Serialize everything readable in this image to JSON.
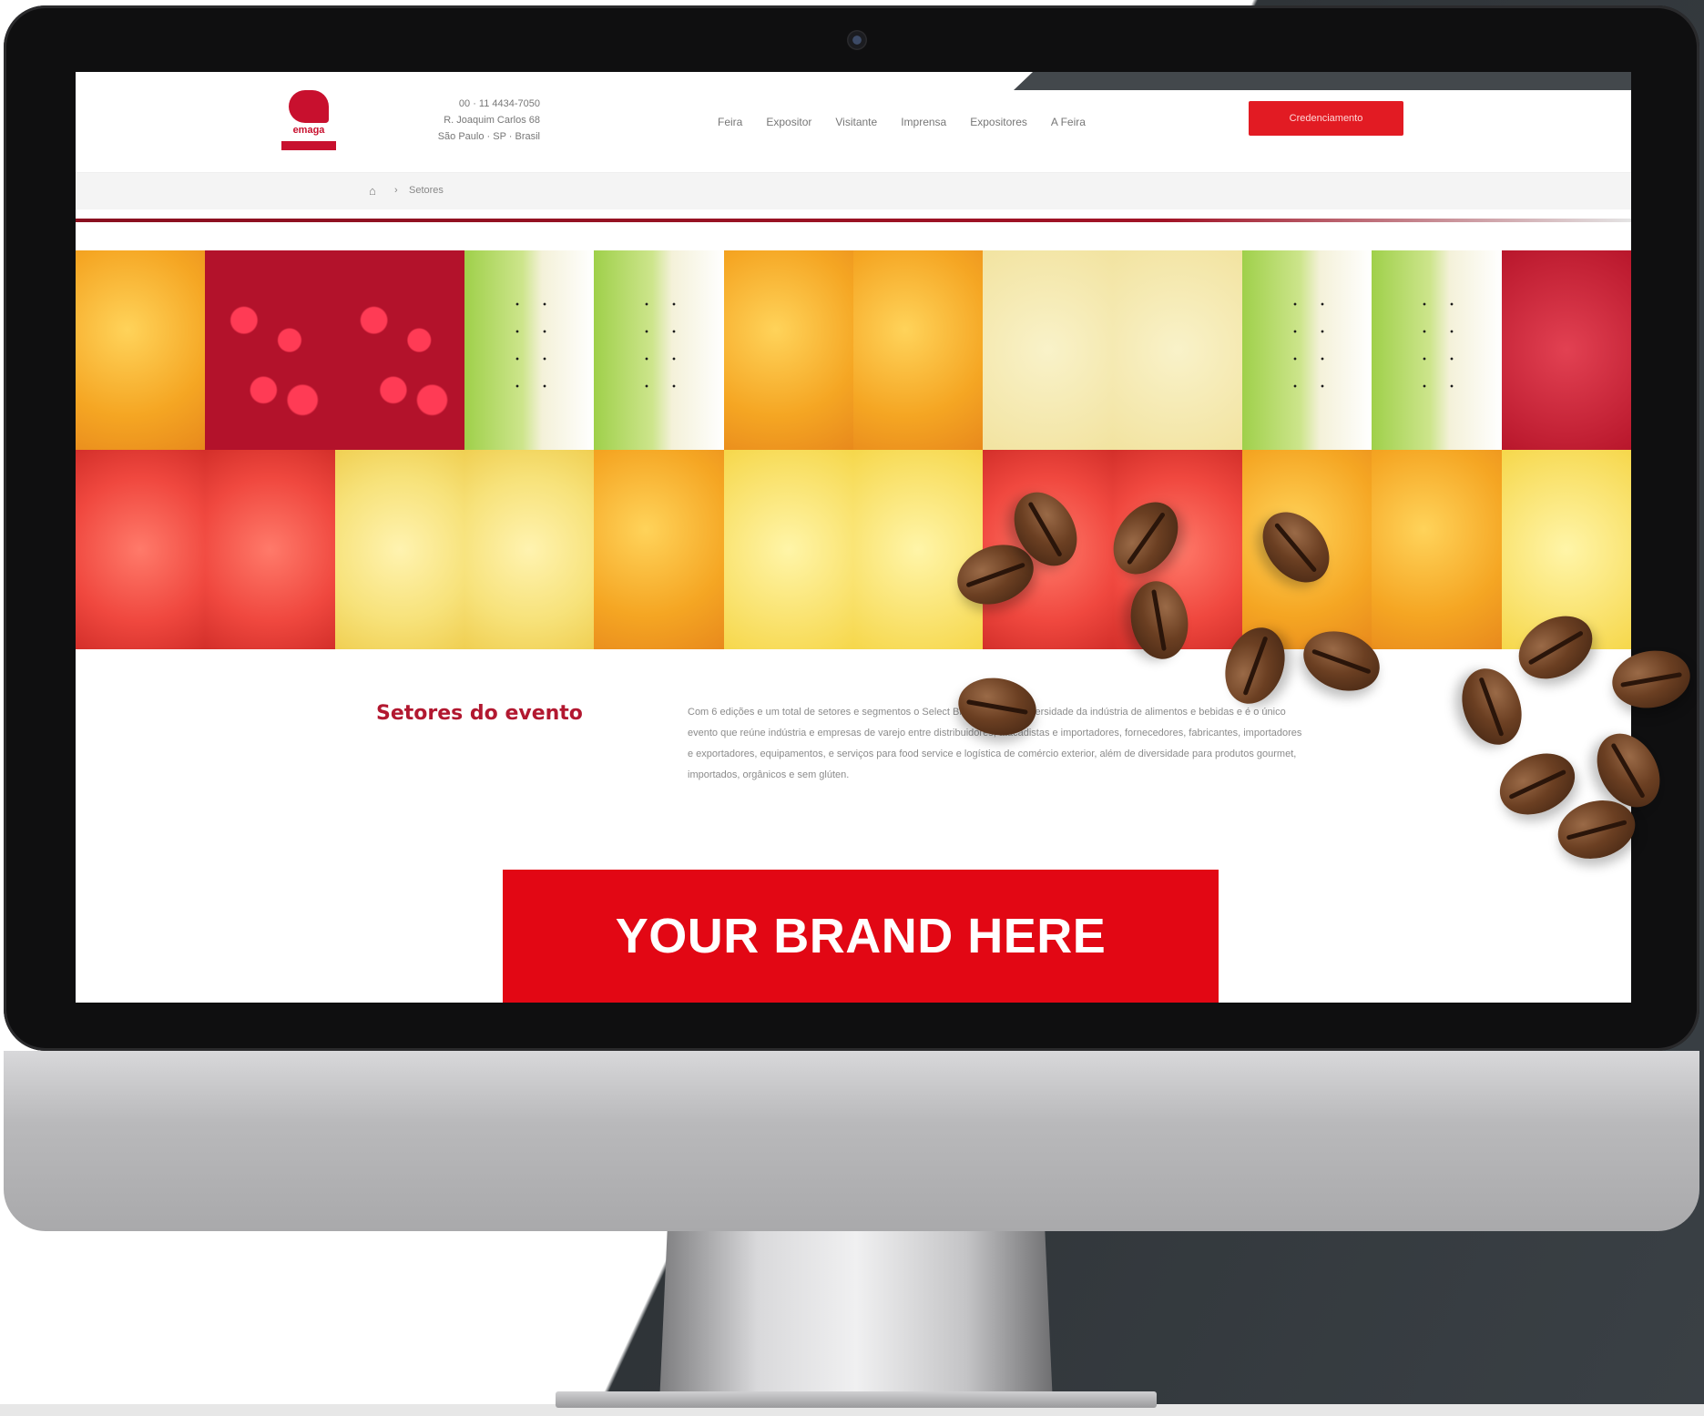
{
  "site": {
    "logo_text": "emaga",
    "contact_lines": [
      "00 · 11 4434-7050",
      "R. Joaquim Carlos 68",
      "São Paulo · SP · Brasil"
    ],
    "nav": [
      "Feira",
      "Expositor",
      "Visitante",
      "Imprensa",
      "Expositores",
      "A Feira"
    ],
    "cta_label": "Credenciamento",
    "breadcrumb": {
      "home_icon": "home-icon",
      "separator": "›",
      "current": "Setores"
    }
  },
  "content": {
    "section_title": "Setores do evento",
    "section_body": "Com 6 edições e um total de setores e segmentos o Select Brasil mostra a diversidade da indústria de alimentos e bebidas e é o único evento que reúne indústria e empresas de varejo entre distribuidores, atacadistas e importadores, fornecedores, fabricantes, importadores e exportadores, equipamentos, e serviços para food service e logística de comércio exterior, além de diversidade para produtos gourmet, importados, orgânicos e sem glúten.",
    "brand_label": "YOUR BRAND HERE"
  },
  "colors": {
    "brand_red": "#e20714",
    "title_red": "#b21830",
    "bezel": "#0f0f10"
  }
}
